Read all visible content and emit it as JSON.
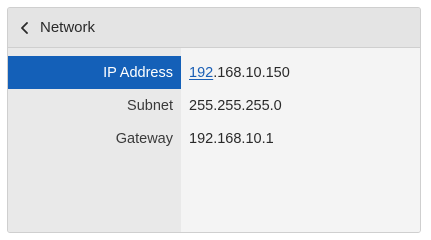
{
  "header": {
    "title": "Network",
    "back_icon": "chevron-left-icon"
  },
  "fields": [
    {
      "label": "IP Address",
      "value_prefix": "192",
      "value_rest": ".168.10.150",
      "selected": true
    },
    {
      "label": "Subnet",
      "value": "255.255.255.0"
    },
    {
      "label": "Gateway",
      "value": "192.168.10.1"
    }
  ],
  "colors": {
    "selected": "#1460b8",
    "edit_highlight": "#1b5fb5"
  }
}
